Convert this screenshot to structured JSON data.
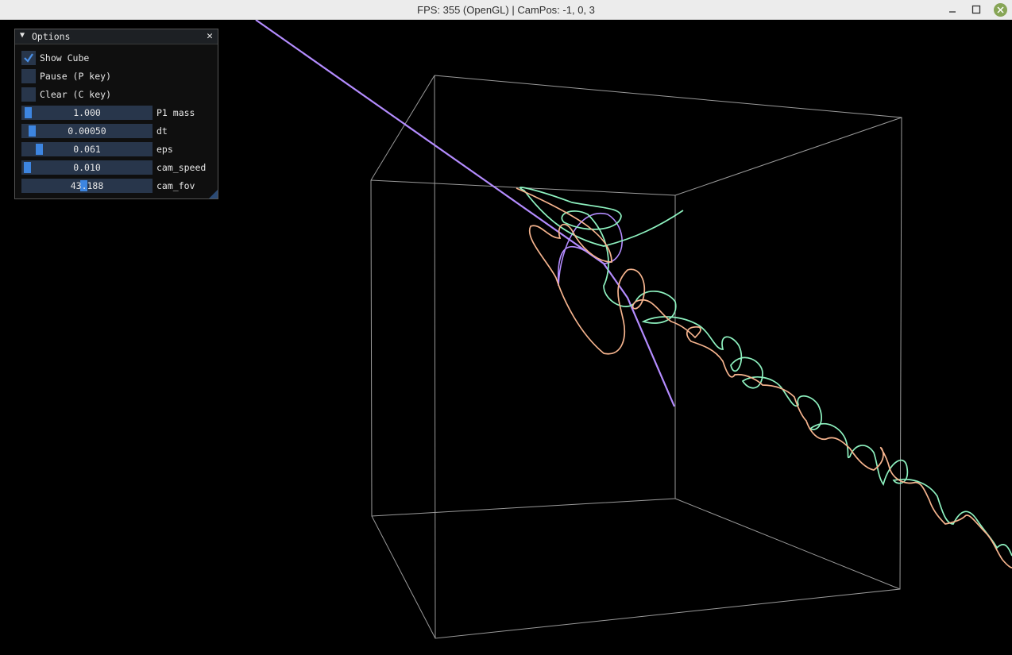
{
  "window": {
    "title": "FPS: 355 (OpenGL) | CamPos: -1, 0, 3",
    "controls": [
      "minimize",
      "maximize",
      "close"
    ]
  },
  "options_panel": {
    "title": "Options",
    "checkboxes": [
      {
        "label": "Show Cube",
        "checked": true
      },
      {
        "label": "Pause (P key)",
        "checked": false
      },
      {
        "label": "Clear (C key)",
        "checked": false
      }
    ],
    "sliders": [
      {
        "label": "P1 mass",
        "value": "1.000",
        "position": 0.02
      },
      {
        "label": "dt",
        "value": "0.00050",
        "position": 0.05
      },
      {
        "label": "eps",
        "value": "0.061",
        "position": 0.12
      },
      {
        "label": "cam_speed",
        "value": "0.010",
        "position": 0.01
      },
      {
        "label": "cam_fov",
        "value": "43.188",
        "position": 0.46
      }
    ]
  },
  "scene": {
    "cube_color": "#9a9a9a",
    "trail_colors": {
      "purple": "#b48cff",
      "green": "#8ef2c0",
      "orange": "#f6b48e"
    }
  }
}
